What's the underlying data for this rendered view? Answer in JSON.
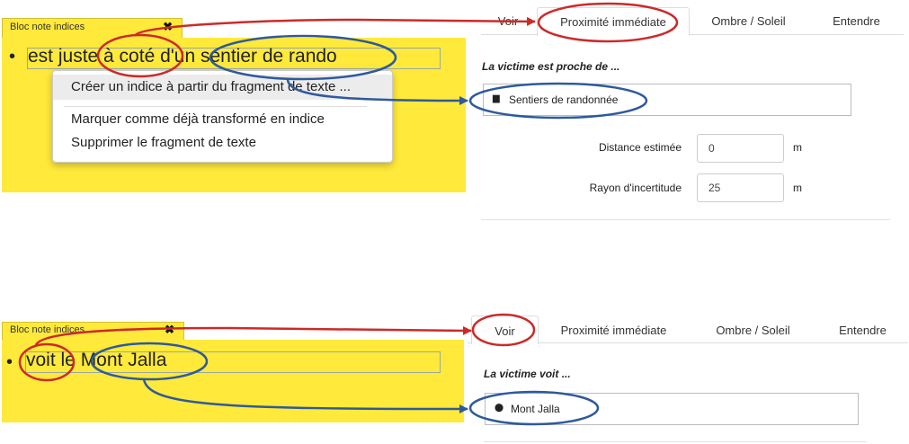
{
  "top": {
    "note": {
      "title": "Bloc note indices",
      "close": "✖",
      "bullet": "•",
      "text": "est juste à coté d'un sentier de rando"
    },
    "menu": {
      "items": [
        "Créer un indice à partir du fragment de texte ...",
        "Marquer comme déjà transformé en indice",
        "Supprimer le fragment de texte"
      ]
    },
    "tabs": [
      "Voir",
      "Proximité immédiate",
      "Ombre / Soleil",
      "Entendre"
    ],
    "active_tab": "Proximité immédiate",
    "section_title": "La victime est proche de ...",
    "selection": {
      "icon": "folder-plus-icon",
      "icon_glyph": "▆",
      "label": "Sentiers de randonnée"
    },
    "fields": [
      {
        "label": "Distance estimée",
        "value": "0",
        "unit": "m"
      },
      {
        "label": "Rayon d'incertitude",
        "value": "25",
        "unit": "m"
      }
    ]
  },
  "bottom": {
    "note": {
      "title": "Bloc note indices",
      "close": "✖",
      "bullet": "•",
      "text": "voit le Mont Jalla"
    },
    "tabs": [
      "Voir",
      "Proximité immédiate",
      "Ombre / Soleil",
      "Entendre"
    ],
    "active_tab": "Voir",
    "section_title": "La victime voit ...",
    "selection": {
      "icon": "map-marker-icon",
      "icon_glyph": "⬤",
      "label": "Mont Jalla"
    }
  },
  "colors": {
    "note_yellow": "#ffe93a",
    "annot_red": "#cc2a2a",
    "annot_blue": "#2e5a9c"
  }
}
